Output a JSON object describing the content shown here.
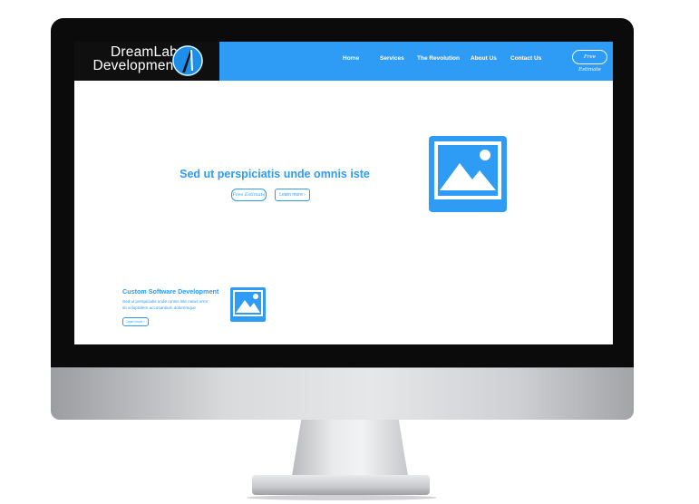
{
  "brand": {
    "line1": "DreamLab",
    "line2": "Development",
    "accent_color": "#2e9bf5"
  },
  "nav": {
    "items": [
      "Home",
      "Services",
      "The Revolution",
      "About Us",
      "Contact Us"
    ],
    "cta": "Free Estimate"
  },
  "hero": {
    "title": "Sed ut perspiciatis unde omnis iste",
    "primary_button": "Free Estimate",
    "secondary_button": "Learn more  ›",
    "image_icon": "image-placeholder-icon"
  },
  "section": {
    "title": "Custom Software Development",
    "body_line1": "Sed ut perspiciatis unde omnis iste natus error",
    "body_line2": "sit voluptatem accusantium doloremque",
    "button": "Learn more  ›",
    "image_icon": "image-placeholder-icon"
  }
}
